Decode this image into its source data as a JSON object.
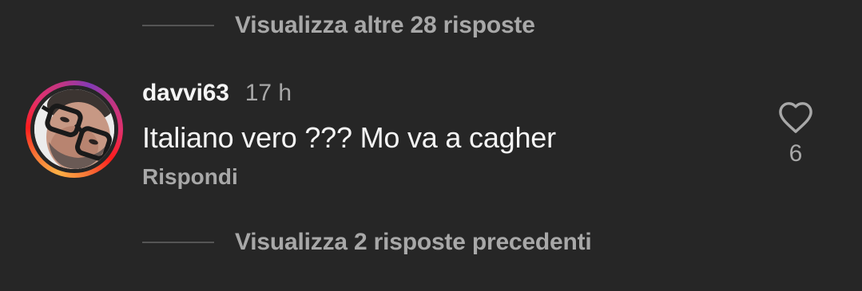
{
  "thread": {
    "view_more_top": "Visualizza altre 28 risposte",
    "view_more_bottom": "Visualizza 2 risposte precedenti"
  },
  "comment": {
    "username": "davvi63",
    "timestamp": "17 h",
    "text": "Italiano vero ??? Mo va a cagher",
    "reply_label": "Rispondi",
    "like_count": "6",
    "avatar_icon": "user-avatar",
    "like_icon": "heart-outline-icon"
  },
  "colors": {
    "background": "#262626",
    "primary_text": "#f5f5f5",
    "secondary_text": "#a8a8a8",
    "divider": "#555555",
    "story_ring": [
      "#fcaf45",
      "#fd1d1d",
      "#e1306c",
      "#833ab4"
    ]
  }
}
